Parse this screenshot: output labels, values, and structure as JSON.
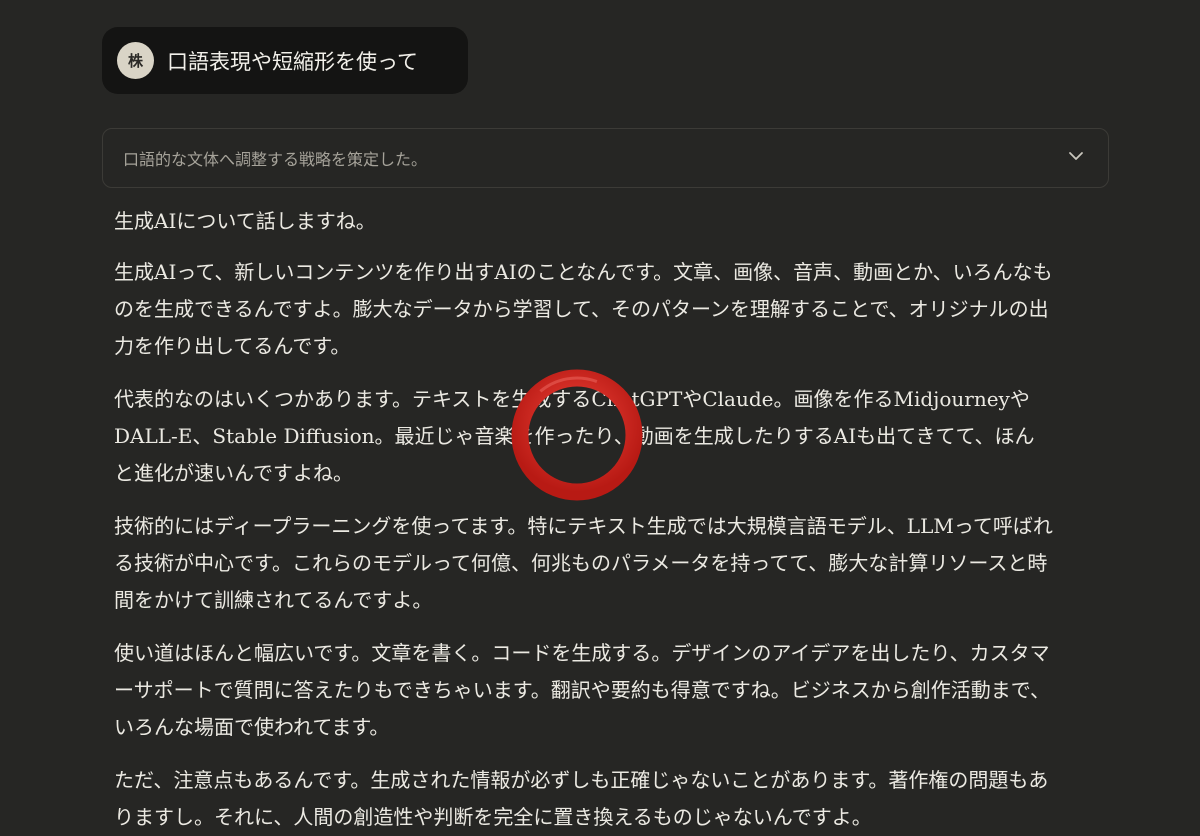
{
  "user_message": {
    "avatar_initial": "株",
    "text": "口語表現や短縮形を使って"
  },
  "thinking": {
    "summary": "口語的な文体へ調整する戦略を策定した。",
    "expand_icon": "chevron-down-icon"
  },
  "response": {
    "paragraphs": [
      "生成AIについて話しますね。",
      "生成AIって、新しいコンテンツを作り出すAIのことなんです。文章、画像、音声、動画とか、いろんなものを生成できるんですよ。膨大なデータから学習して、そのパターンを理解することで、オリジナルの出力を作り出してるんです。",
      "代表的なのはいくつかあります。テキストを生成するChatGPTやClaude。画像を作るMidjourneyやDALL-E、Stable Diffusion。最近じゃ音楽を作ったり、動画を生成したりするAIも出てきてて、ほんと進化が速いんですよね。",
      "技術的にはディープラーニングを使ってます。特にテキスト生成では大規模言語モデル、LLMって呼ばれる技術が中心です。これらのモデルって何億、何兆ものパラメータを持ってて、膨大な計算リソースと時間をかけて訓練されてるんですよ。",
      "使い道はほんと幅広いです。文章を書く。コードを生成する。デザインのアイデアを出したり、カスタマーサポートで質問に答えたりもできちゃいます。翻訳や要約も得意ですね。ビジネスから創作活動まで、いろんな場面で使われてます。",
      "ただ、注意点もあるんです。生成された情報が必ずしも正確じゃないことがあります。著作権の問題もありますし。それに、人間の創造性や判断を完全に置き換えるものじゃないんですよ。"
    ]
  },
  "colors": {
    "background": "#262624",
    "user_bubble": "#141413",
    "marker": "#d8261e"
  }
}
